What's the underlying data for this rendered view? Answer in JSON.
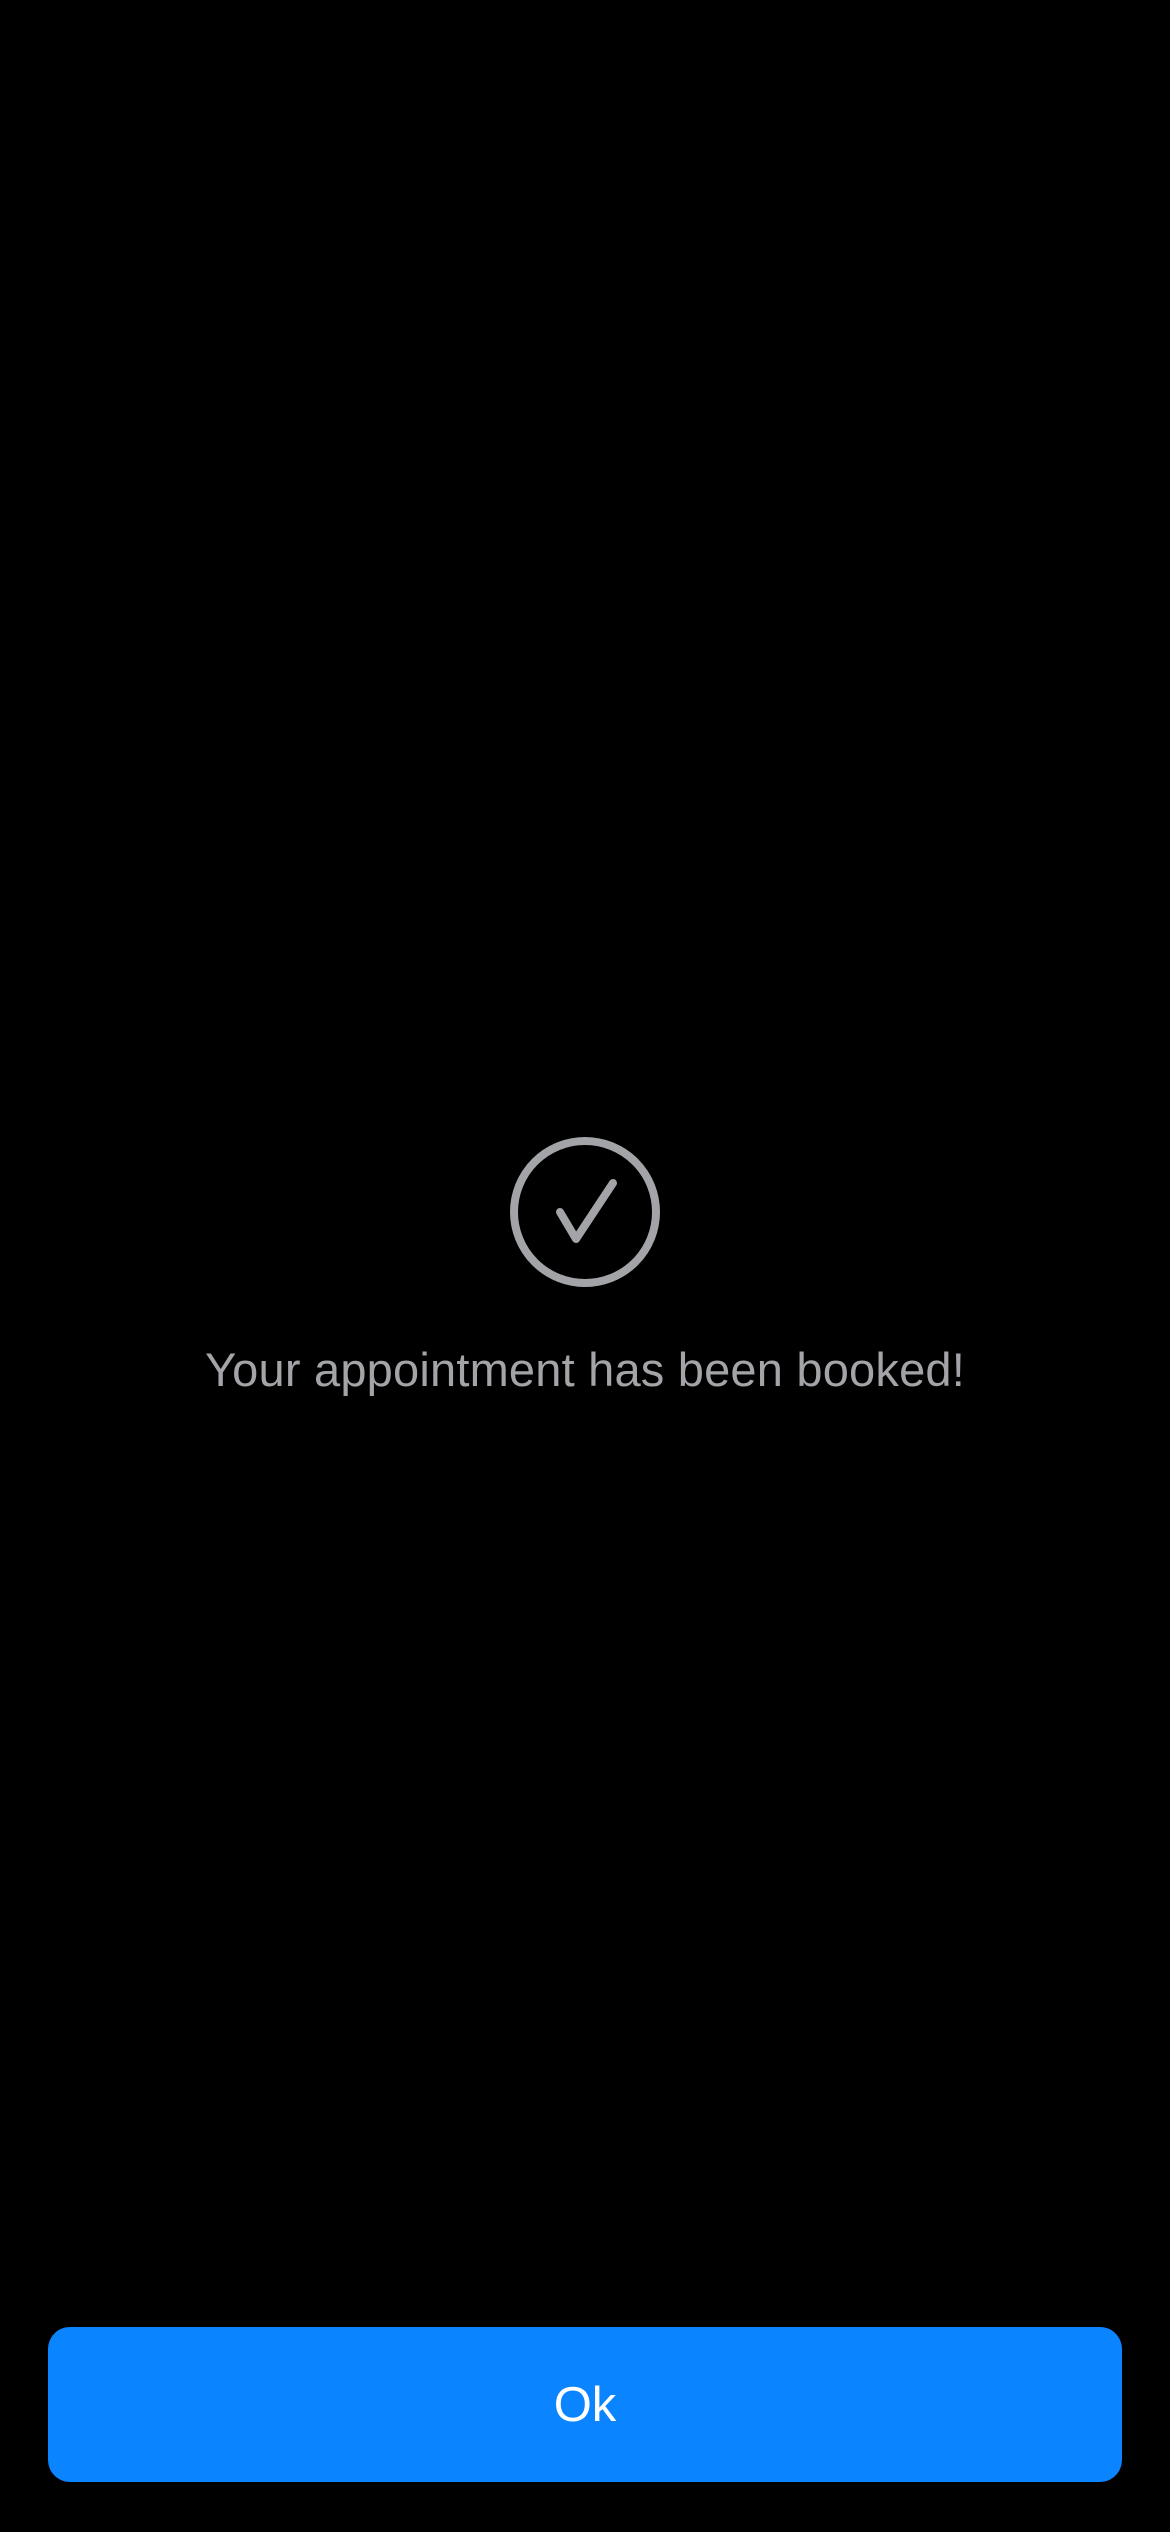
{
  "confirmation": {
    "icon": "checkmark-circle-icon",
    "message": "Your appointment has been booked!"
  },
  "actions": {
    "ok_label": "Ok"
  },
  "colors": {
    "background": "#000000",
    "accent": "#0A84FF",
    "muted_text": "#A2A4A8",
    "button_text": "#FFFFFF"
  }
}
